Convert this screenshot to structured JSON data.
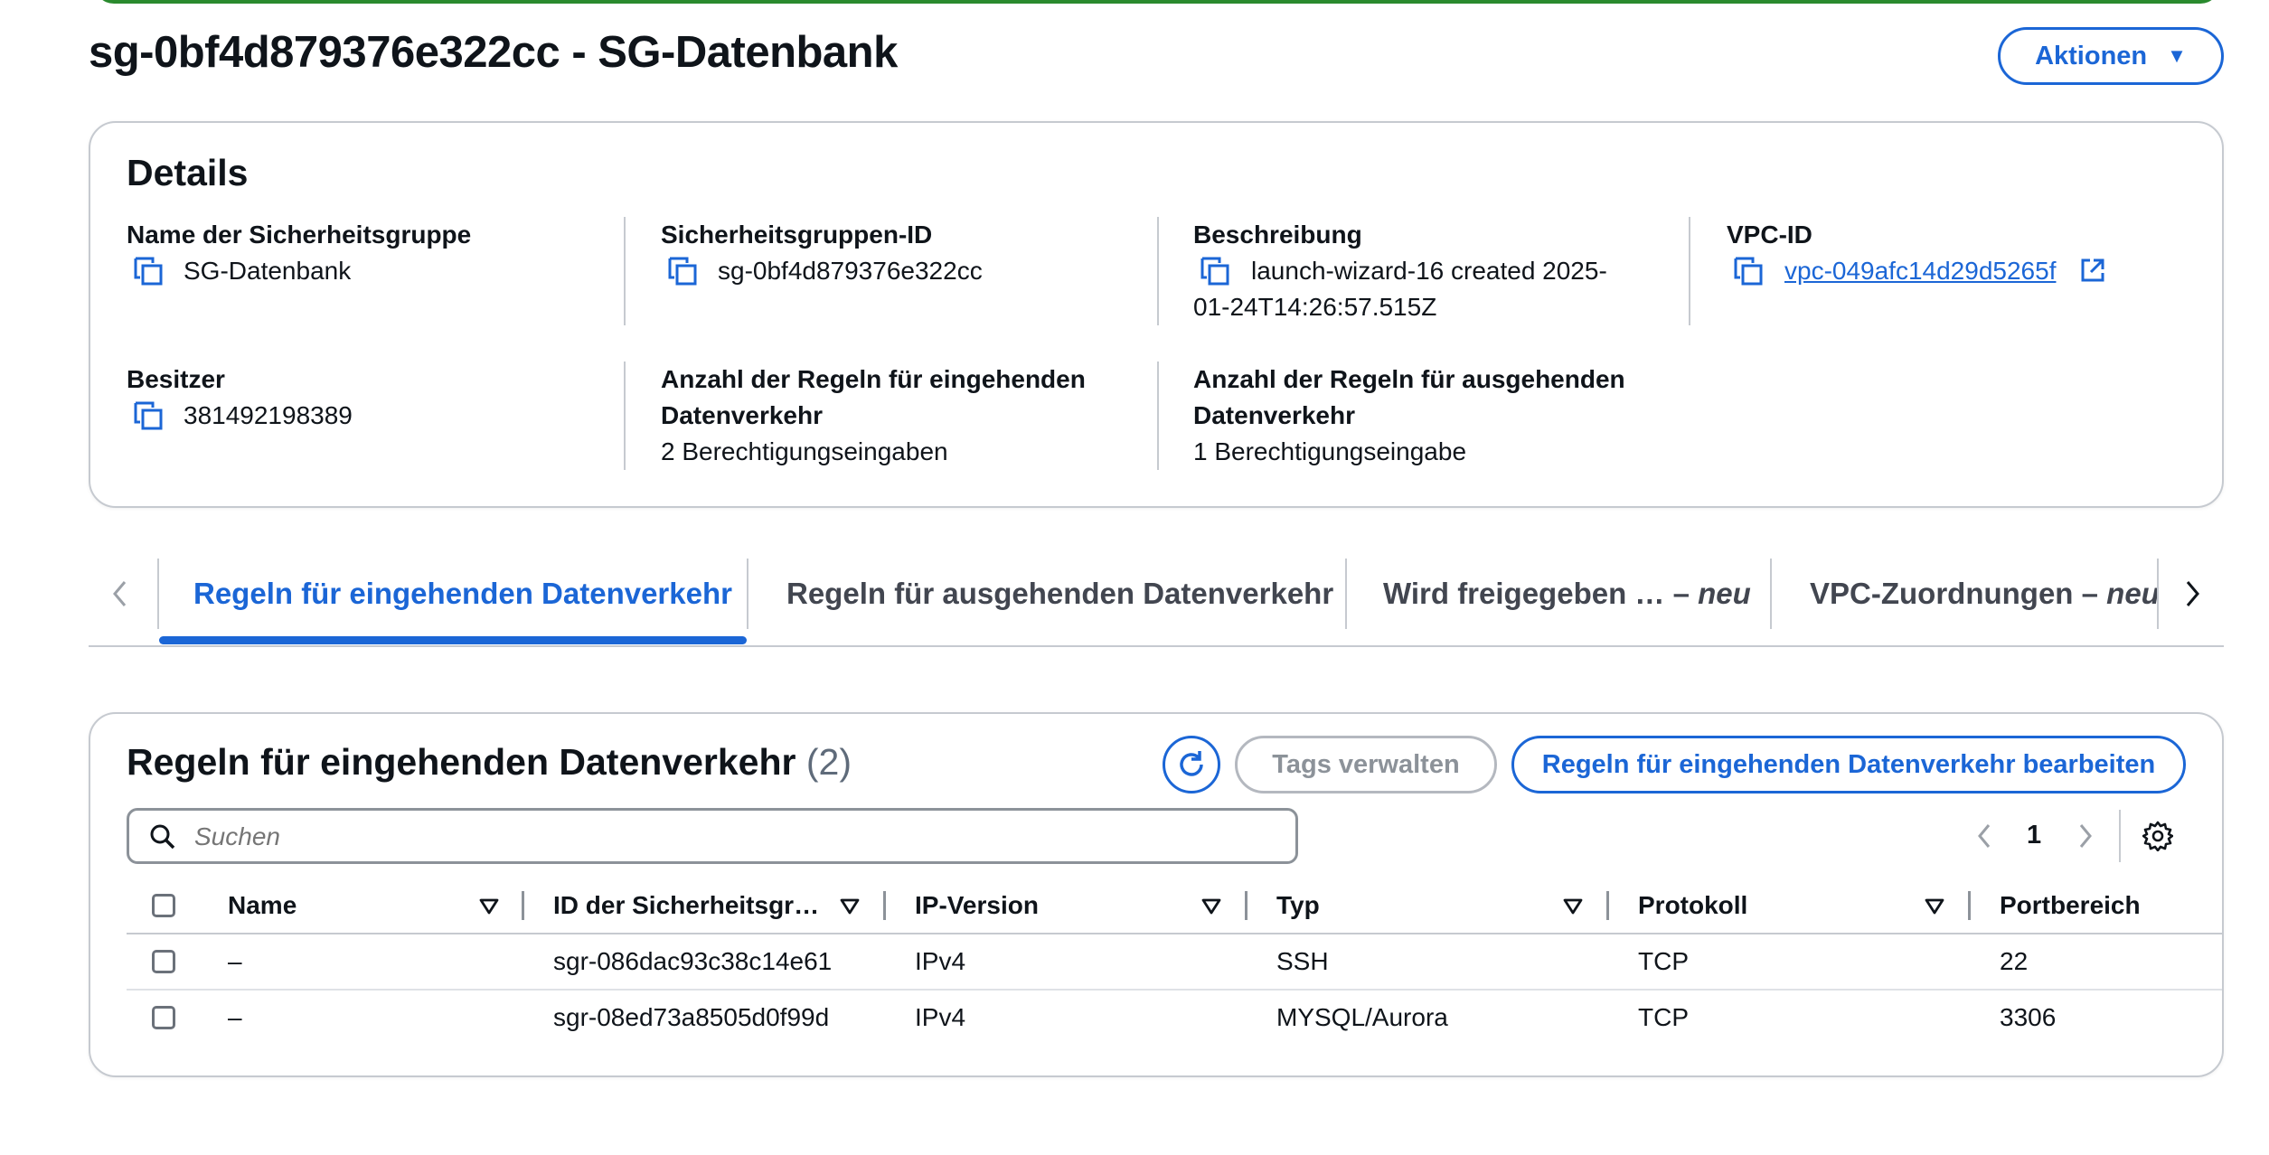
{
  "header": {
    "title": "sg-0bf4d879376e322cc - SG-Datenbank",
    "actions_label": "Aktionen",
    "actions_caret": "▼"
  },
  "details": {
    "heading": "Details",
    "fields": {
      "name_label": "Name der Sicherheitsgruppe",
      "name_value": "SG-Datenbank",
      "id_label": "Sicherheitsgruppen-ID",
      "id_value": "sg-0bf4d879376e322cc",
      "desc_label": "Beschreibung",
      "desc_value_line1": "launch-wizard-16 created 2025-",
      "desc_value_line2": "01-24T14:26:57.515Z",
      "vpc_label": "VPC-ID",
      "vpc_value": "vpc-049afc14d29d5265f",
      "owner_label": "Besitzer",
      "owner_value": "381492198389",
      "inbound_count_label_line1": "Anzahl der Regeln für eingehenden",
      "inbound_count_label_line2": "Datenverkehr",
      "inbound_count_value": "2 Berechtigungseingaben",
      "outbound_count_label_line1": "Anzahl der Regeln für ausgehenden",
      "outbound_count_label_line2": "Datenverkehr",
      "outbound_count_value": "1 Berechtigungseingabe"
    }
  },
  "tabs": [
    {
      "label": "Regeln für eingehenden Datenverkehr",
      "suffix": "",
      "active": true
    },
    {
      "label": "Regeln für ausgehenden Datenverkehr",
      "suffix": "",
      "active": false
    },
    {
      "label": "Wird freigegeben … – ",
      "suffix": "neu",
      "active": false
    },
    {
      "label": "VPC-Zuordnungen – ",
      "suffix": "neu",
      "active": false
    }
  ],
  "rules_panel": {
    "title": "Regeln für eingehenden Datenverkehr",
    "count": "(2)",
    "manage_tags_label": "Tags verwalten",
    "edit_label": "Regeln für eingehenden Datenverkehr bearbeiten",
    "search_placeholder": "Suchen",
    "page_number": "1",
    "columns": [
      "Name",
      "ID der Sicherheitsgr…",
      "IP-Version",
      "Typ",
      "Protokoll",
      "Portbereich"
    ],
    "rows": [
      {
        "name": "–",
        "id": "sgr-086dac93c38c14e61",
        "ip_version": "IPv4",
        "type": "SSH",
        "protocol": "TCP",
        "port": "22"
      },
      {
        "name": "–",
        "id": "sgr-08ed73a8505d0f99d",
        "ip_version": "IPv4",
        "type": "MYSQL/Aurora",
        "protocol": "TCP",
        "port": "3306"
      }
    ]
  },
  "colors": {
    "accent": "#1b66d6",
    "success_banner": "#2a8a2e",
    "border": "#c6cad0",
    "text": "#0f141a"
  },
  "icons": [
    "copy-icon",
    "external-link-icon",
    "refresh-icon",
    "search-icon",
    "chevron-left-icon",
    "chevron-right-icon",
    "settings-gear-icon",
    "sort-caret-icon",
    "caret-down-icon"
  ]
}
